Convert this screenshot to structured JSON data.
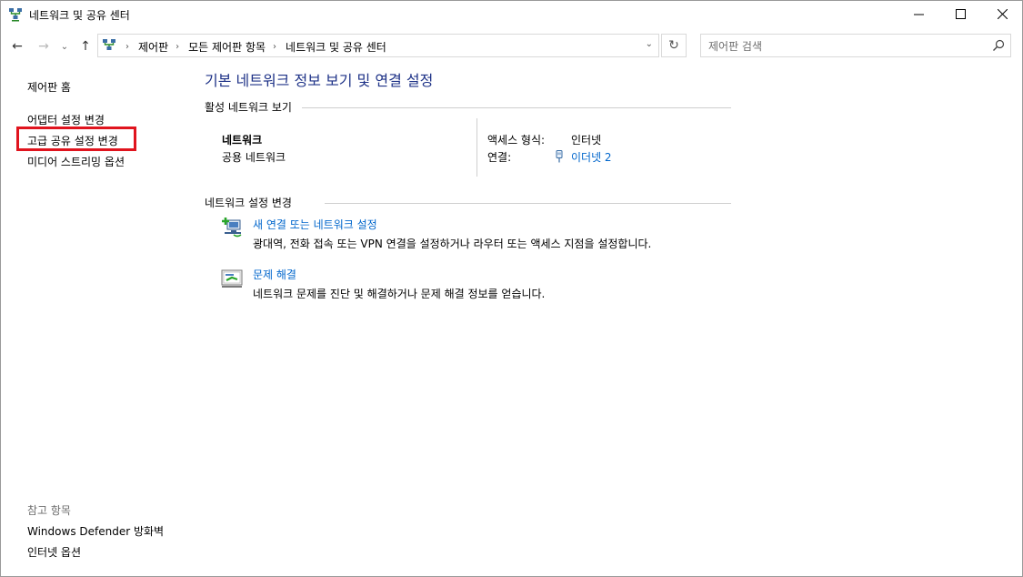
{
  "window": {
    "title": "네트워크 및 공유 센터",
    "controls": {
      "minimize": "—",
      "maximize": "☐",
      "close": "✕"
    }
  },
  "address_bar": {
    "breadcrumbs": [
      "제어판",
      "모든 제어판 항목",
      "네트워크 및 공유 센터"
    ],
    "separator": "›",
    "dropdown_glyph": "⌄",
    "refresh_glyph": "↻"
  },
  "nav": {
    "back": "←",
    "forward": "→",
    "recent": "⌄",
    "up": "↑"
  },
  "search": {
    "placeholder": "제어판 검색",
    "value": ""
  },
  "left_pane": {
    "home": "제어판 홈",
    "items": [
      "어댑터 설정 변경",
      "고급 공유 설정 변경",
      "미디어 스트리밍 옵션"
    ],
    "see_also_header": "참고 항목",
    "see_also": [
      "Windows Defender 방화벽",
      "인터넷 옵션"
    ]
  },
  "main": {
    "title": "기본 네트워크 정보 보기 및 연결 설정",
    "active_networks": {
      "header": "활성 네트워크 보기",
      "network_name": "네트워크",
      "network_type": "공용 네트워크",
      "access_type_label": "액세스 형식:",
      "access_type_value": "인터넷",
      "connections_label": "연결:",
      "connections_value": "이더넷 2"
    },
    "change_settings": {
      "header": "네트워크 설정 변경",
      "tasks": [
        {
          "title": "새 연결 또는 네트워크 설정",
          "description": "광대역, 전화 접속 또는 VPN 연결을 설정하거나 라우터 또는 액세스 지점을 설정합니다."
        },
        {
          "title": "문제 해결",
          "description": "네트워크 문제를 진단 및 해결하거나 문제 해결 정보를 얻습니다."
        }
      ]
    }
  },
  "colors": {
    "title_blue": "#1e3287",
    "link_blue": "#0066cc",
    "highlight_red": "#e0141e"
  },
  "icons": [
    "network-center-icon",
    "ethernet-icon",
    "new-connection-icon",
    "troubleshoot-icon",
    "search-icon"
  ]
}
